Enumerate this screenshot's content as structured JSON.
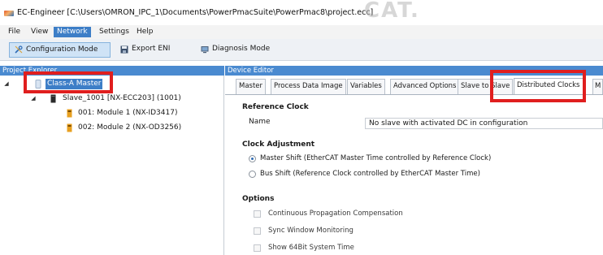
{
  "window": {
    "title": "EC-Engineer [C:\\Users\\OMRON_IPC_1\\Documents\\PowerPmacSuite\\PowerPmac8\\project.ecc]",
    "background_text": "CAT."
  },
  "menu": {
    "items": [
      "File",
      "View",
      "Network",
      "Settings",
      "Help"
    ],
    "active": "Network"
  },
  "toolbar": {
    "config_mode_label": "Configuration Mode",
    "export_eni_label": "Export ENI",
    "diagnosis_mode_label": "Diagnosis Mode"
  },
  "project_explorer": {
    "header": "Project Explorer",
    "tree": {
      "master": "Class-A Master",
      "slave": "Slave_1001 [NX-ECC203] (1001)",
      "modules": [
        "001: Module 1 (NX-ID3417)",
        "002: Module 2 (NX-OD3256)"
      ]
    }
  },
  "device_editor": {
    "header": "Device Editor",
    "tabs": [
      "Master",
      "Process Data Image",
      "Variables",
      "Advanced Options",
      "Slave to Slave",
      "Distributed Clocks",
      "M"
    ],
    "active_tab": "Distributed Clocks",
    "reference_clock": {
      "title": "Reference Clock",
      "name_label": "Name",
      "name_value": "No slave with activated DC in configuration"
    },
    "clock_adjustment": {
      "title": "Clock Adjustment",
      "options": [
        {
          "label": "Master Shift (EtherCAT Master Time controlled by Reference Clock)",
          "checked": true
        },
        {
          "label": "Bus Shift (Reference Clock controlled by EtherCAT Master Time)",
          "checked": false
        }
      ]
    },
    "options": {
      "title": "Options",
      "items": [
        {
          "label": "Continuous Propagation Compensation",
          "checked": false
        },
        {
          "label": "Sync Window Monitoring",
          "checked": false
        },
        {
          "label": "Show 64Bit System Time",
          "checked": false
        }
      ]
    }
  },
  "colors": {
    "accent_blue": "#3d7ec7",
    "header_blue": "#4a8ad0",
    "highlight_red": "#e01e1e"
  }
}
